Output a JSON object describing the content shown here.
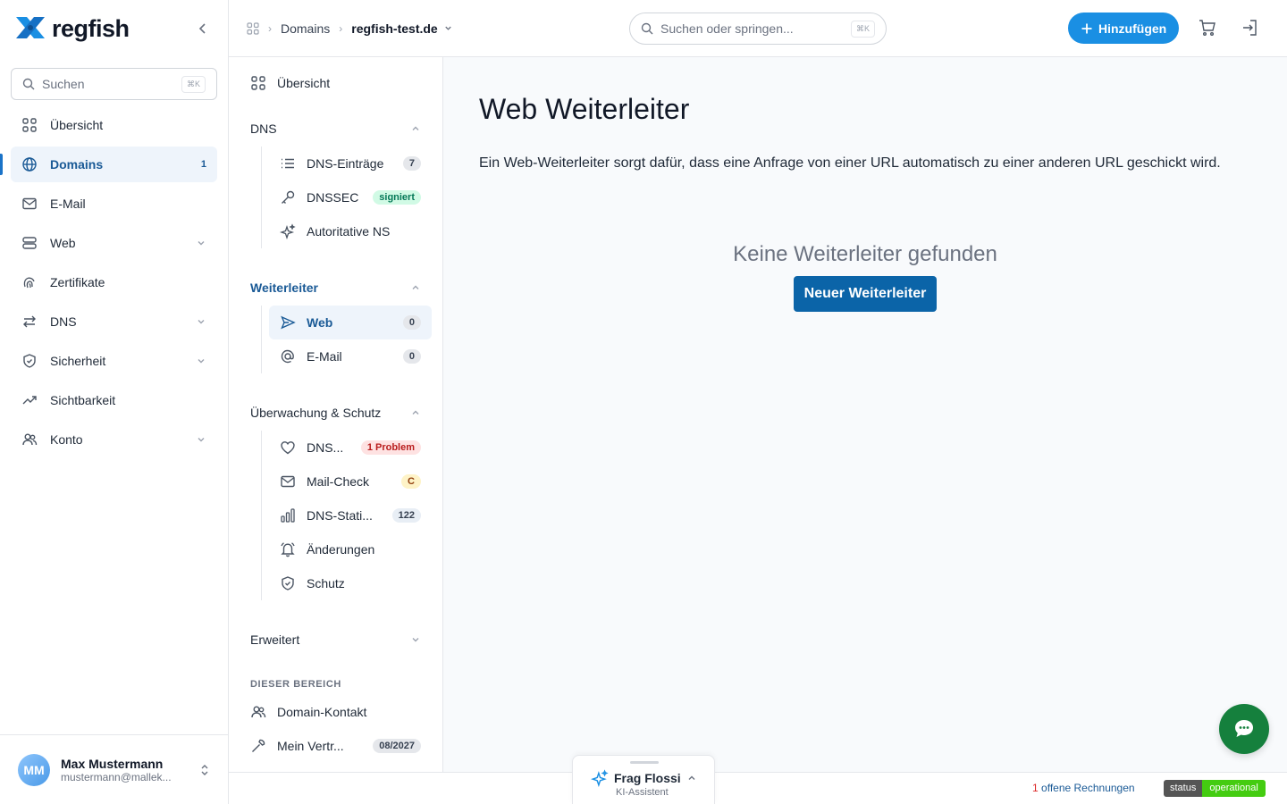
{
  "brand": {
    "name": "regfish",
    "primary": "#1a8fe3",
    "accent": "#1a5a96"
  },
  "sidebar": {
    "search_placeholder": "Suchen",
    "search_kbd": "⌘K",
    "items": [
      {
        "label": "Übersicht",
        "icon": "grid-icon"
      },
      {
        "label": "Domains",
        "icon": "globe-icon",
        "count": "1",
        "active": true
      },
      {
        "label": "E-Mail",
        "icon": "mail-icon"
      },
      {
        "label": "Web",
        "icon": "server-icon",
        "expandable": true
      },
      {
        "label": "Zertifikate",
        "icon": "fingerprint-icon"
      },
      {
        "label": "DNS",
        "icon": "arrows-icon",
        "expandable": true
      },
      {
        "label": "Sicherheit",
        "icon": "shield-icon",
        "expandable": true
      },
      {
        "label": "Sichtbarkeit",
        "icon": "trend-icon"
      },
      {
        "label": "Konto",
        "icon": "users-icon",
        "expandable": true
      }
    ]
  },
  "user": {
    "initials": "MM",
    "name": "Max Mustermann",
    "email": "mustermann@mallek..."
  },
  "topbar": {
    "breadcrumb": [
      "Domains",
      "regfish-test.de"
    ],
    "search_placeholder": "Suchen oder springen...",
    "search_kbd": "⌘K",
    "add_label": "Hinzufügen"
  },
  "subnav": {
    "overview": "Übersicht",
    "dns": {
      "title": "DNS",
      "items": [
        {
          "label": "DNS-Einträge",
          "badge": "7"
        },
        {
          "label": "DNSSEC",
          "badge": "signiert"
        },
        {
          "label": "Autoritative NS"
        }
      ]
    },
    "forwarders": {
      "title": "Weiterleiter",
      "items": [
        {
          "label": "Web",
          "badge": "0",
          "active": true
        },
        {
          "label": "E-Mail",
          "badge": "0"
        }
      ]
    },
    "monitoring": {
      "title": "Überwachung & Schutz",
      "items": [
        {
          "label": "DNS...",
          "badge": "1 Problem"
        },
        {
          "label": "Mail-Check",
          "badge": "C"
        },
        {
          "label": "DNS-Stati...",
          "badge": "122"
        },
        {
          "label": "Änderungen"
        },
        {
          "label": "Schutz"
        }
      ]
    },
    "advanced": "Erweitert",
    "area_label": "DIESER BEREICH",
    "area_items": [
      {
        "label": "Domain-Kontakt"
      },
      {
        "label": "Mein Vertr...",
        "badge": "08/2027"
      }
    ]
  },
  "main": {
    "title": "Web Weiterleiter",
    "description": "Ein Web-Weiterleiter sorgt dafür, dass eine Anfrage von einer URL automatisch zu einer anderen URL geschickt wird.",
    "empty_title": "Keine Weiterleiter gefunden",
    "new_button": "Neuer Weiterleiter"
  },
  "assistant": {
    "title": "Frag Flossi",
    "subtitle": "KI-Assistent"
  },
  "footer": {
    "invoice_count": "1",
    "invoice_text": " offene Rechnungen",
    "status_left": "status",
    "status_right": "operational"
  }
}
